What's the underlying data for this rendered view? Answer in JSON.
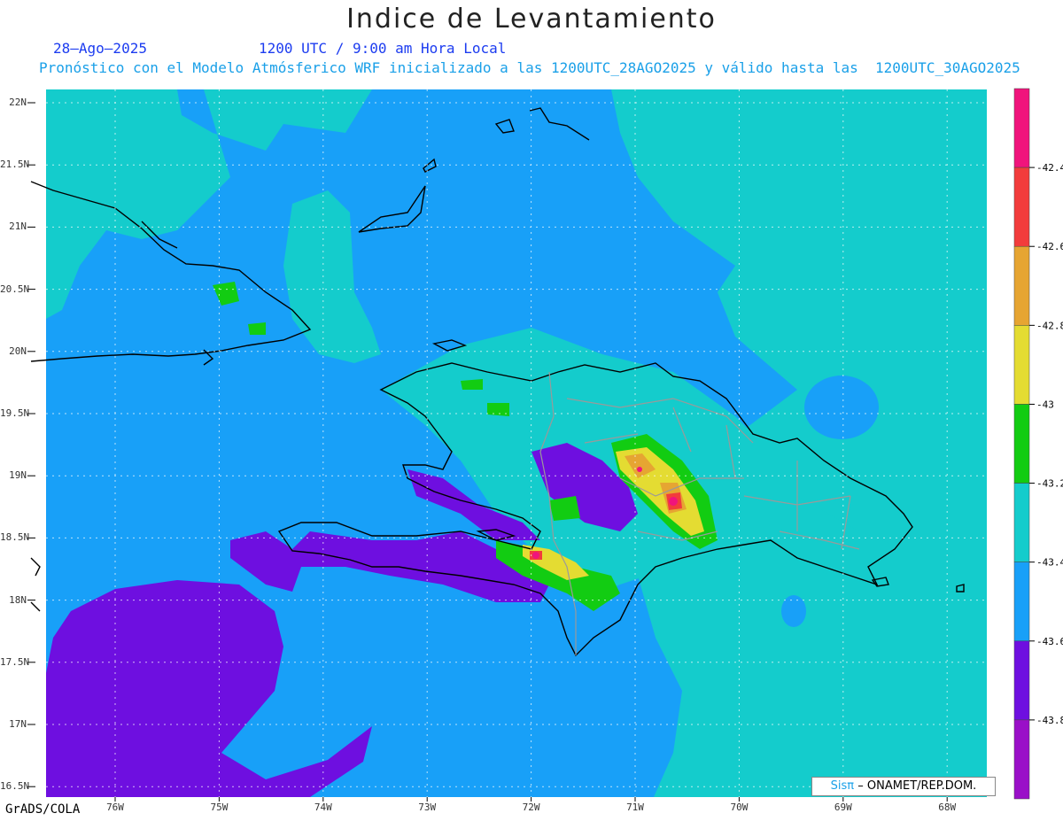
{
  "header": {
    "title": "Indice de Levantamiento",
    "date": "28–Ago–2025",
    "time": "1200 UTC / 9:00 am Hora Local",
    "forecast_note": "Pronóstico con el Modelo Atmósferico WRF inicializado a las 1200UTC_28AGO2025 y válido hasta las  1200UTC_30AGO2025"
  },
  "axes": {
    "lat_labels": [
      "22N",
      "21.5N",
      "21N",
      "20.5N",
      "20N",
      "19.5N",
      "19N",
      "18.5N",
      "18N",
      "17.5N",
      "17N",
      "16.5N"
    ],
    "lon_labels": [
      "76W",
      "75W",
      "74W",
      "73W",
      "72W",
      "71W",
      "70W",
      "69W",
      "68W"
    ]
  },
  "colorbar": {
    "labels": [
      "-42.4",
      "-42.6",
      "-42.8",
      "-43",
      "-43.2",
      "-43.4",
      "-43.6",
      "-43.8"
    ],
    "colors": [
      "#f0147c",
      "#f23c3c",
      "#e6a532",
      "#e4dc32",
      "#12cc12",
      "#14cccc",
      "#18a0f8",
      "#6e0fe0",
      "#9a0fc8"
    ]
  },
  "credit": {
    "brand": "Sisπ",
    "org": "– ONAMET/REP.DOM."
  },
  "footer": {
    "software": "GrADS/COLA"
  }
}
